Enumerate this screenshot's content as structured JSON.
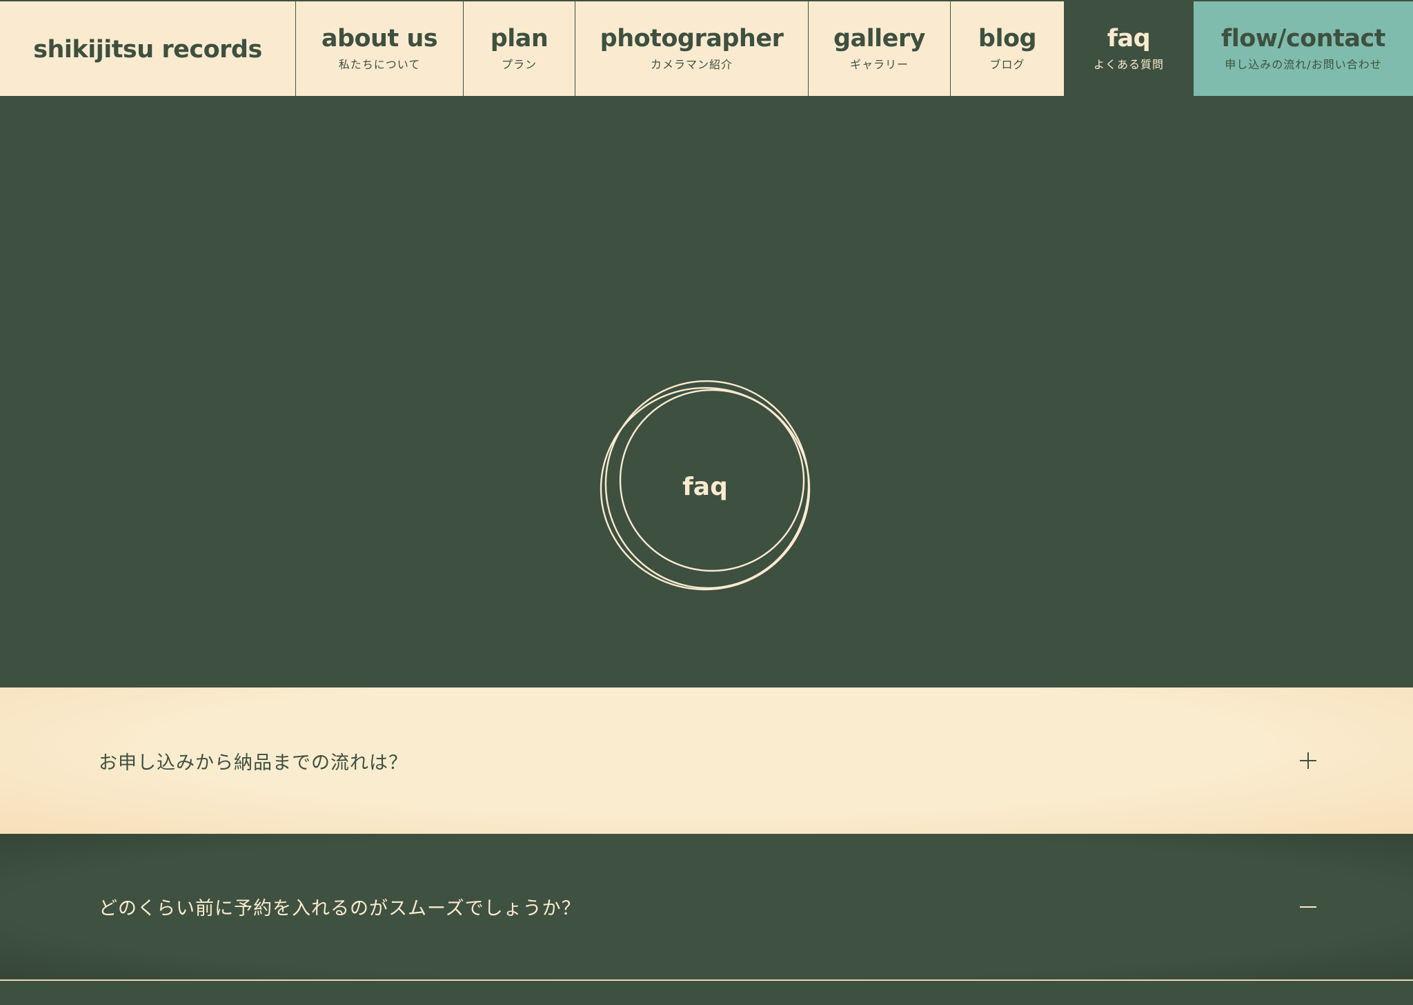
{
  "nav": {
    "logo": "shikijitsu records",
    "items": [
      {
        "en": "about us",
        "jp": "私たちについて"
      },
      {
        "en": "plan",
        "jp": "プラン"
      },
      {
        "en": "photographer",
        "jp": "カメラマン紹介"
      },
      {
        "en": "gallery",
        "jp": "ギャラリー"
      },
      {
        "en": "blog",
        "jp": "ブログ"
      },
      {
        "en": "faq",
        "jp": "よくある質問",
        "active": true
      },
      {
        "en": "flow/contact",
        "jp": "申し込みの流れ/お問い合わせ"
      }
    ]
  },
  "hero": {
    "title": "faq"
  },
  "faq": [
    {
      "question": "お申し込みから納品までの流れは？",
      "toggle": "plus-icon"
    },
    {
      "question": "どのくらい前に予約を入れるのがスムーズでしょうか？",
      "toggle": "minus-icon"
    }
  ],
  "colors": {
    "dark_green": "#3e5040",
    "cream": "#faebd0",
    "teal": "#7fbcad"
  }
}
